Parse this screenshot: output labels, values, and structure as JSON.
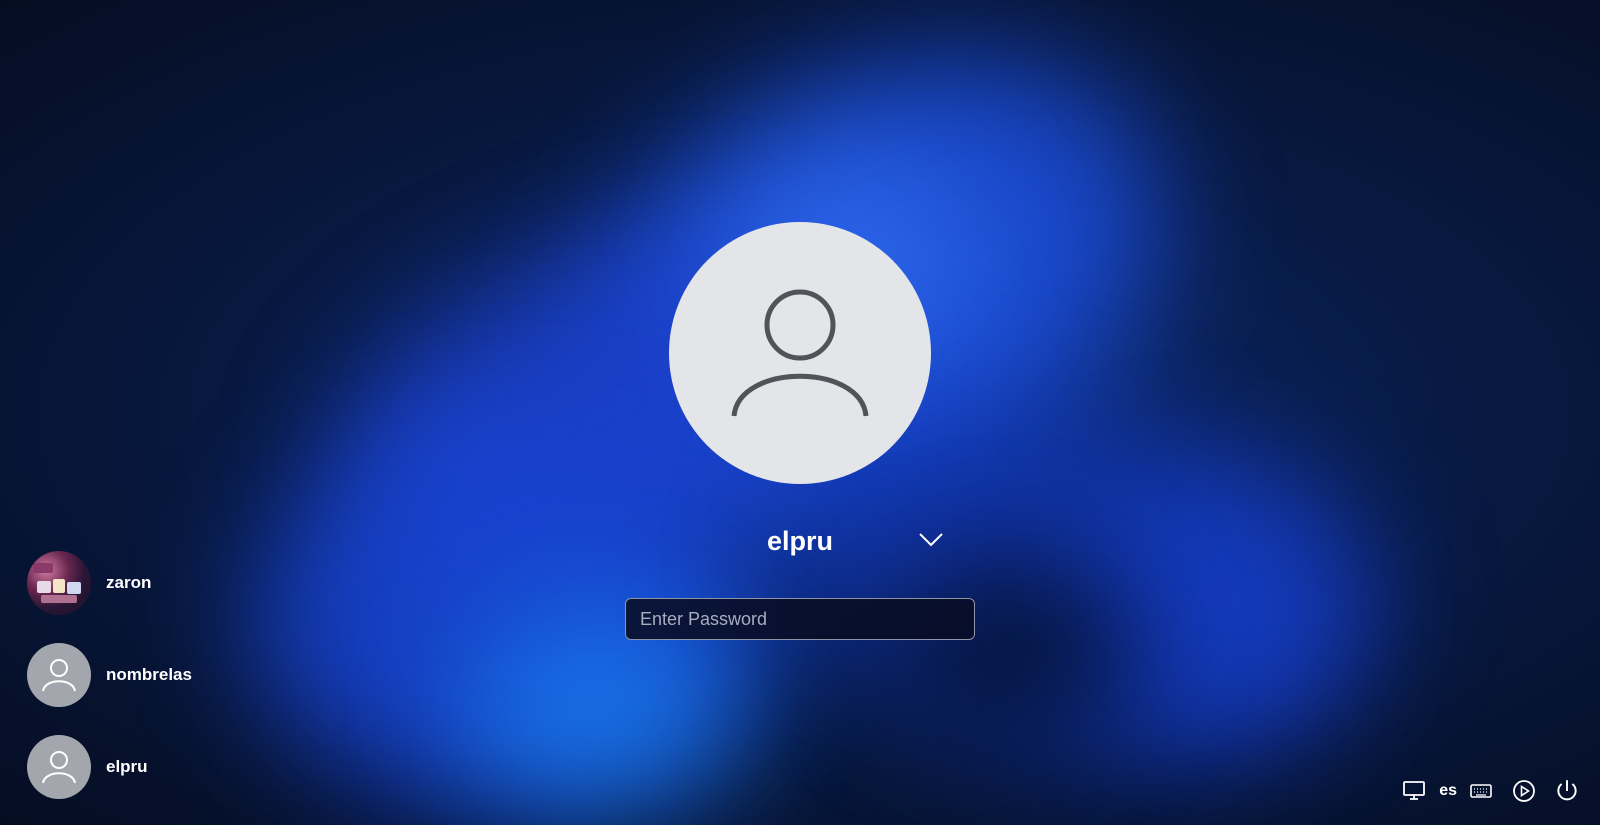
{
  "selected_user": {
    "name": "elpru",
    "avatar_icon": "default-user-avatar",
    "dropdown_icon": "chevron-down-icon"
  },
  "password": {
    "value": "",
    "placeholder": "Enter Password"
  },
  "users": [
    {
      "name": "zaron",
      "avatar": "photo"
    },
    {
      "name": "nombrelas",
      "avatar": "default-user-avatar"
    },
    {
      "name": "elpru",
      "avatar": "default-user-avatar"
    }
  ],
  "tray": {
    "display_icon": "monitor-icon",
    "language": "es",
    "keyboard_icon": "keyboard-icon",
    "accessibility_icon": "play-circle-icon",
    "power_icon": "power-icon"
  },
  "colors": {
    "avatar_background": "#e4e5e8",
    "small_avatar_background": "#a3a7ad",
    "wallpaper_accent": "#1c4fe0"
  }
}
